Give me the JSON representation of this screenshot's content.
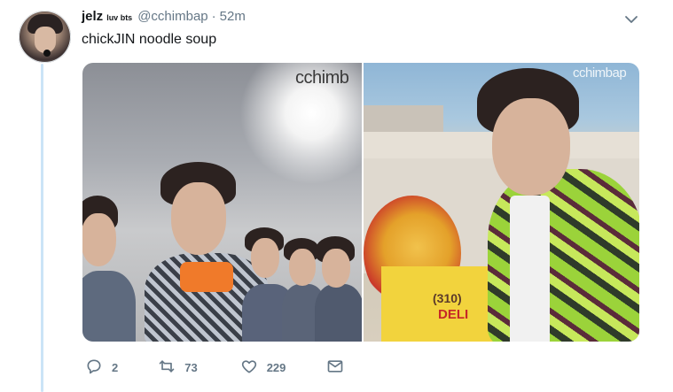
{
  "tweet": {
    "display_name": "jelz",
    "name_superscript": "luv bts",
    "handle": "@cchimbap",
    "separator": "·",
    "time": "52m",
    "text": "chickJIN noodle soup"
  },
  "media": {
    "photos": [
      {
        "watermark": "cchimb"
      },
      {
        "watermark": "cchimbap"
      }
    ],
    "right_photo_sign": {
      "phone": "(310)",
      "deli": "DELI"
    }
  },
  "actions": {
    "reply_count": "2",
    "retweet_count": "73",
    "like_count": "229"
  },
  "icons": {
    "reply": "reply-icon",
    "retweet": "retweet-icon",
    "like": "like-icon",
    "dm": "direct-message-icon",
    "caret": "chevron-down-icon"
  },
  "colors": {
    "text": "#14171a",
    "muted": "#657786",
    "thread_line": "#cbe4f7"
  }
}
